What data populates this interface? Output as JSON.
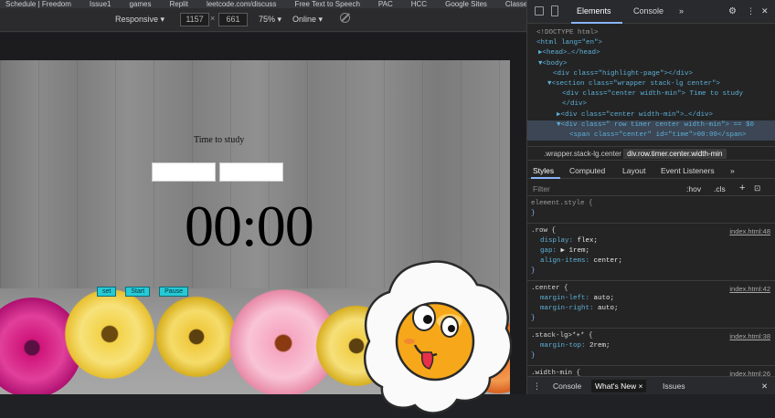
{
  "bookmarks": [
    "Schedule | Freedom",
    "Issue1",
    "games",
    "Replit",
    "leetcode.com/discuss",
    "Free Text to Speech",
    "PAC",
    "HCC",
    "Google Sites",
    "Classes - Program"
  ],
  "device_toolbar": {
    "mode": "Responsive",
    "width": "1157",
    "height": "661",
    "zoom": "75%",
    "throttle": "Online"
  },
  "page": {
    "heading": "Time to study",
    "timer": "00:00",
    "buttons": [
      "set",
      "Start",
      "Pause"
    ]
  },
  "devtools": {
    "tabs": [
      "Elements",
      "Console"
    ],
    "more": "»",
    "dom": [
      "<!DOCTYPE html>",
      "<html lang=\"en\">",
      "▶<head>…</head>",
      "▼<body>",
      "<div class=\"highlight-page\"></div>",
      "▼<section class=\"wrapper stack-lg center\">",
      "<div class=\"center width-min\"> Time to study",
      "</div>",
      "▶<div class=\"center width-min\">…</div>",
      "▼<div class=\" row timer center width-min\"> == $0",
      "<span class=\"center\" id=\"time\">00:00</span>"
    ],
    "breadcrumb": [
      ".wrapper.stack-lg.center",
      "div.row.timer.center.width-min"
    ],
    "style_tabs": [
      "Styles",
      "Computed",
      "Layout",
      "Event Listeners",
      "»"
    ],
    "filter": {
      "placeholder": "Filter",
      "hov": ":hov",
      "cls": ".cls"
    },
    "rules": [
      {
        "selector": "element.style {",
        "source": "",
        "props": []
      },
      {
        "selector": ".row {",
        "source": "index.html:48",
        "props": [
          [
            "display",
            "flex;"
          ],
          [
            "gap",
            "▶ 1rem;"
          ],
          [
            "align-items",
            "center;"
          ]
        ]
      },
      {
        "selector": ".center {",
        "source": "index.html:42",
        "props": [
          [
            "margin-left",
            "auto;"
          ],
          [
            "margin-right",
            "auto;"
          ]
        ]
      },
      {
        "selector": ".stack-lg>*+* {",
        "source": "index.html:38",
        "props": [
          [
            "margin-top",
            "2rem;"
          ]
        ]
      },
      {
        "selector": ".width-min {",
        "source": "index.html:26",
        "props": []
      }
    ],
    "drawer": [
      "Console",
      "What's New ×",
      "Issues"
    ]
  }
}
